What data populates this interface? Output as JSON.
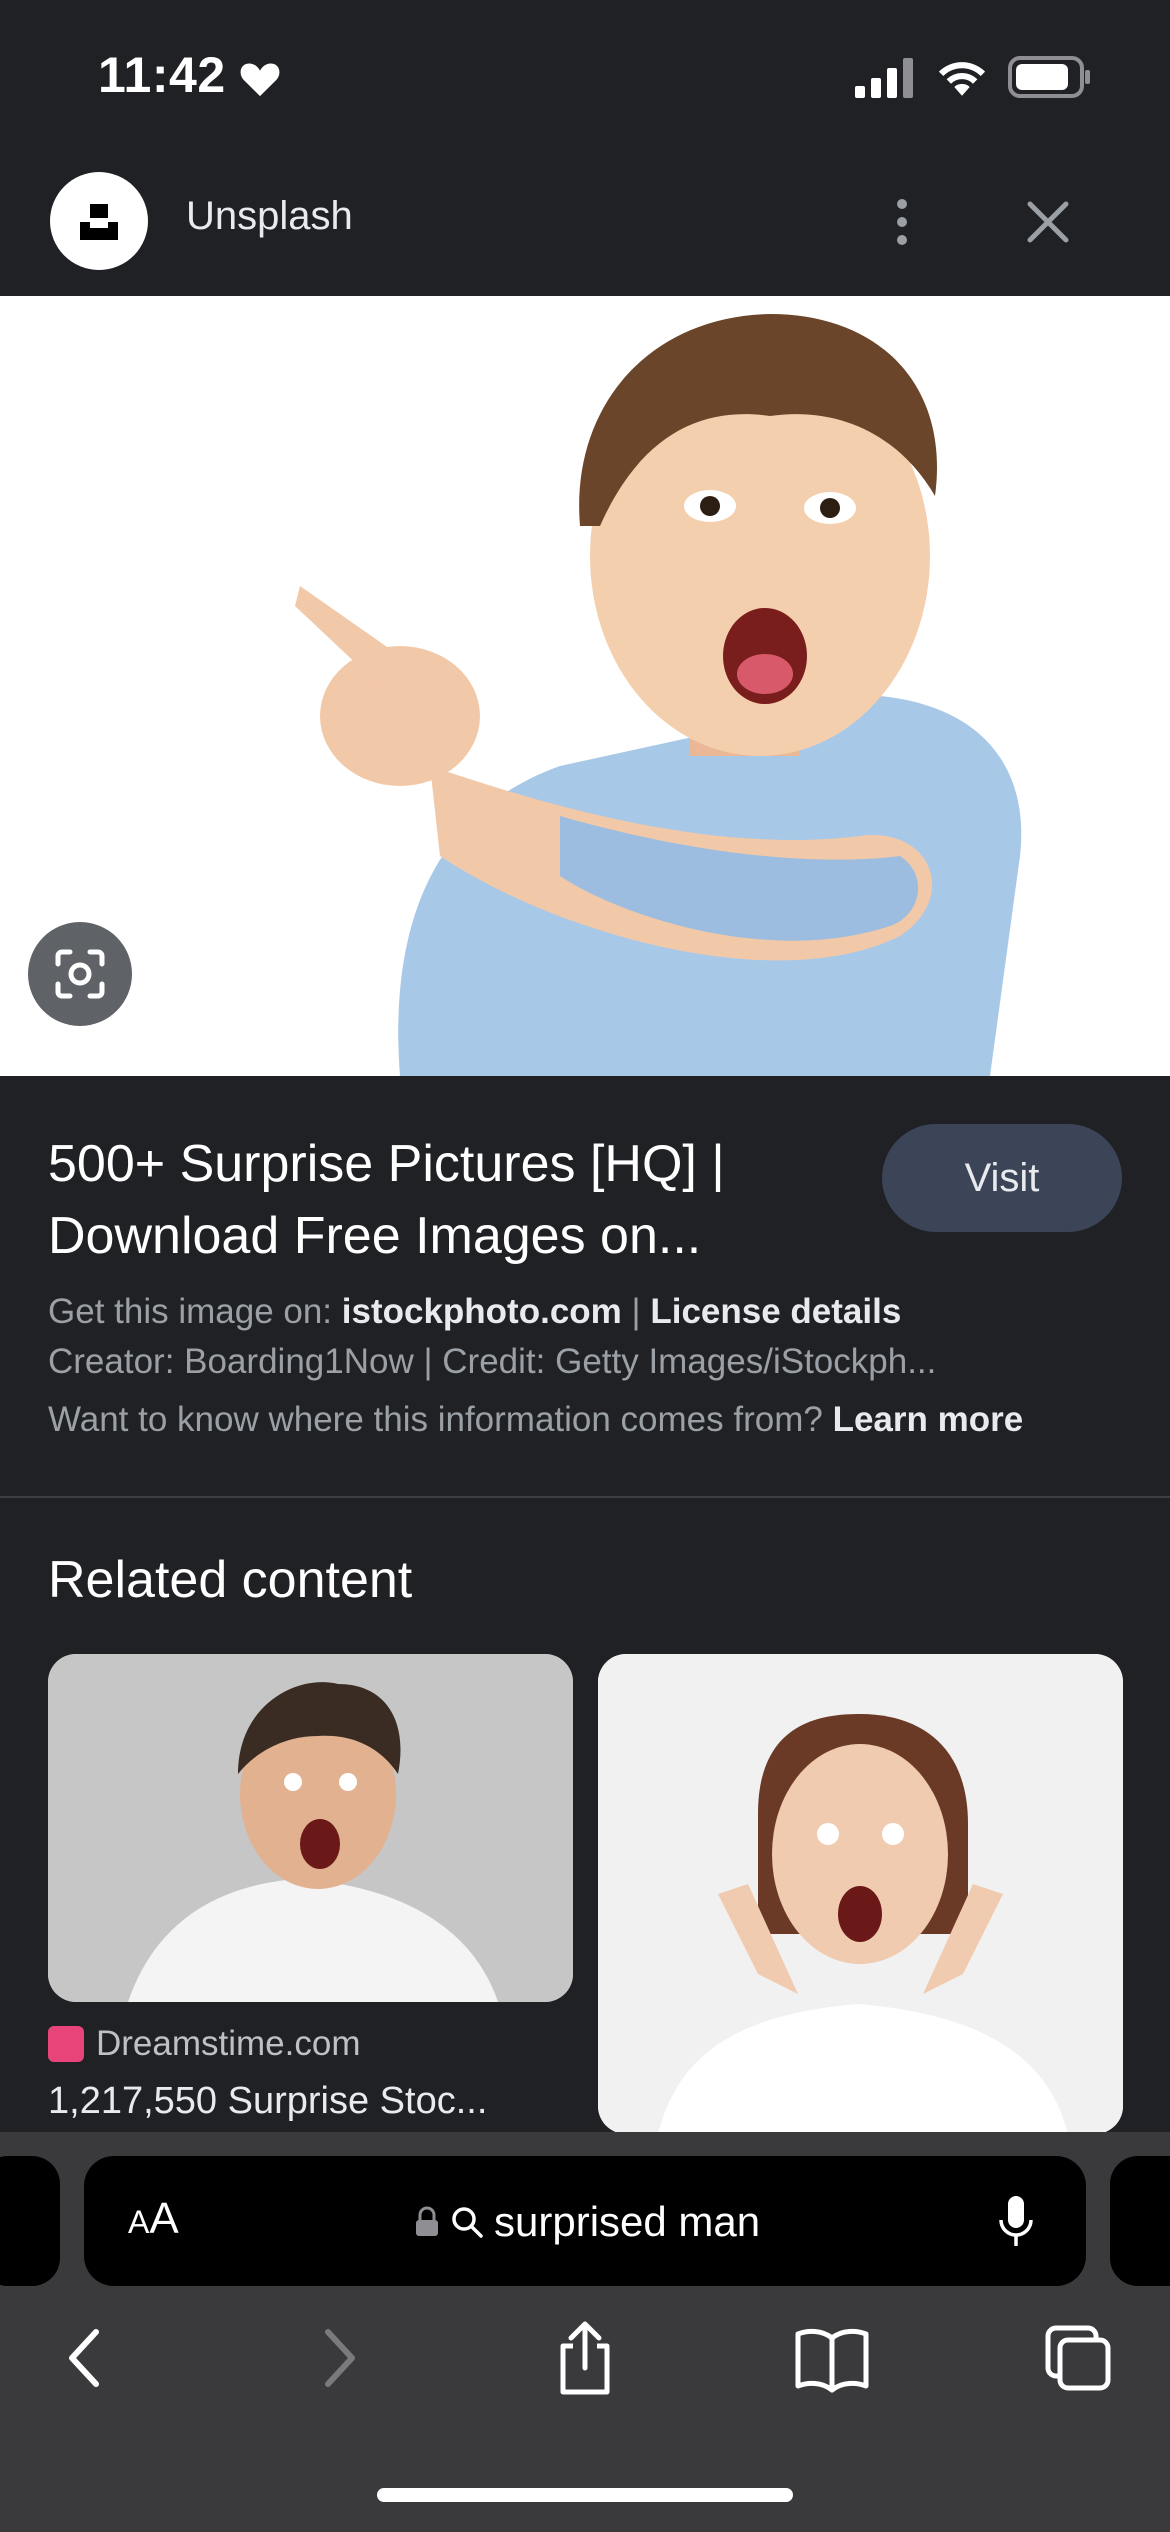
{
  "status_bar": {
    "time": "11:42"
  },
  "header": {
    "site_name": "Unsplash"
  },
  "result": {
    "title": "500+ Surprise Pictures [HQ] | Download Free Images on...",
    "visit_label": "Visit",
    "source_prefix": "Get this image on: ",
    "source_domain": "istockphoto.com",
    "separator": " | ",
    "license_label": "License details",
    "creator_line": "Creator: Boarding1Now | Credit: Getty Images/iStockph...",
    "info_question": "Want to know where this information comes from? ",
    "learn_more": "Learn more"
  },
  "related": {
    "heading": "Related content",
    "cards": [
      {
        "source": "Dreamstime.com",
        "caption": "1,217,550 Surprise Stoc..."
      }
    ]
  },
  "browser": {
    "text_size_label_small": "A",
    "text_size_label_large": "A",
    "url_text": "surprised man"
  },
  "colors": {
    "background": "#202124",
    "visit_button": "#3c4458",
    "toolbar": "#3a3a3c",
    "dreamstime_brand": "#e8447a"
  }
}
